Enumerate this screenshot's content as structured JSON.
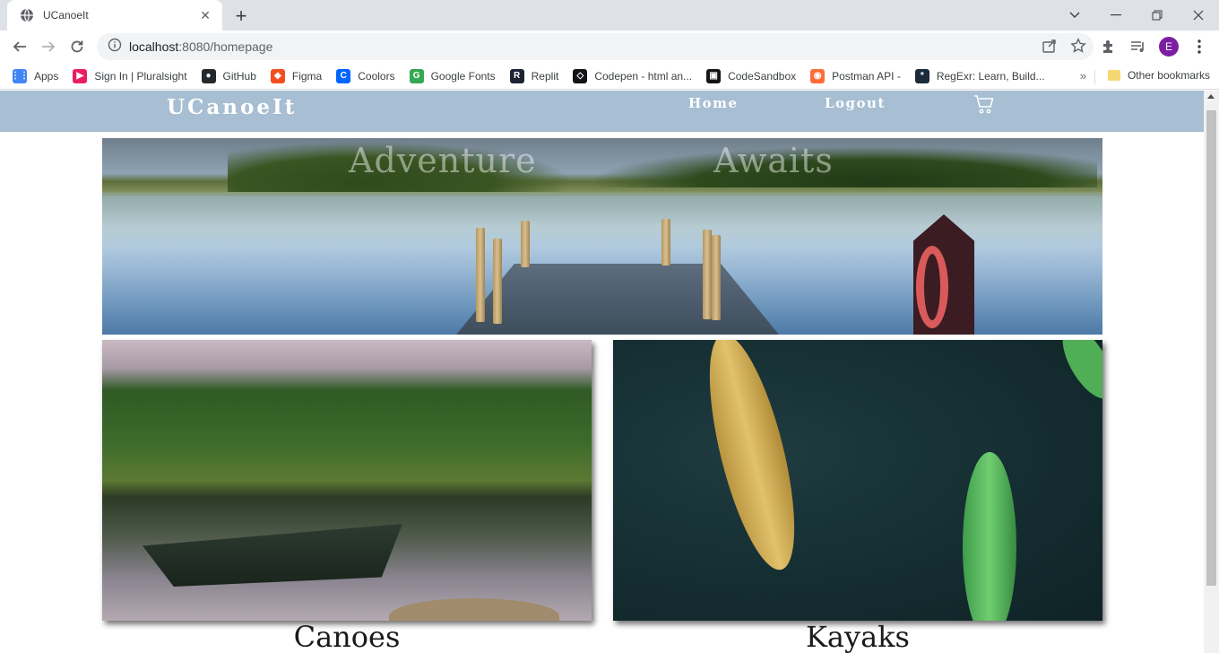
{
  "browser": {
    "tab_title": "UCanoeIt",
    "url_host": "localhost",
    "url_rest": ":8080/homepage",
    "avatar_letter": "E",
    "bookmarks": [
      {
        "label": "Apps",
        "icon": "apps-grid-icon",
        "color": "#4285f4"
      },
      {
        "label": "Sign In | Pluralsight",
        "icon": "pluralsight-icon",
        "color": "#e91e63"
      },
      {
        "label": "GitHub",
        "icon": "github-icon",
        "color": "#24292e"
      },
      {
        "label": "Figma",
        "icon": "figma-icon",
        "color": "#f24e1e"
      },
      {
        "label": "Coolors",
        "icon": "coolors-icon",
        "color": "#0066ff"
      },
      {
        "label": "Google Fonts",
        "icon": "google-fonts-icon",
        "color": "#34a853"
      },
      {
        "label": "Replit",
        "icon": "replit-icon",
        "color": "#1c2333"
      },
      {
        "label": "Codepen - html an...",
        "icon": "codepen-icon",
        "color": "#131417"
      },
      {
        "label": "CodeSandbox",
        "icon": "codesandbox-icon",
        "color": "#151515"
      },
      {
        "label": "Postman API -",
        "icon": "postman-icon",
        "color": "#ff6c37"
      },
      {
        "label": "RegExr: Learn, Build...",
        "icon": "regexr-icon",
        "color": "#1c2b3a"
      }
    ],
    "other_bookmarks": "Other bookmarks"
  },
  "site": {
    "brand": "UCanoeIt",
    "nav": {
      "home": "Home",
      "logout": "Logout"
    },
    "hero": {
      "word1": "Adventure",
      "word2": "Awaits"
    },
    "cards": [
      {
        "label": "Canoes"
      },
      {
        "label": "Kayaks"
      }
    ]
  },
  "colors": {
    "navbar": "#a7bed3",
    "avatar": "#7b1fa2"
  }
}
